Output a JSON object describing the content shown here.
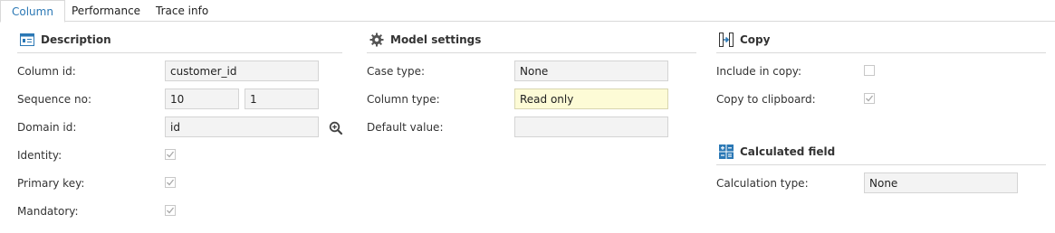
{
  "tabs": [
    {
      "label": "Column",
      "active": true
    },
    {
      "label": "Performance",
      "active": false
    },
    {
      "label": "Trace info",
      "active": false
    }
  ],
  "description": {
    "title": "Description",
    "icon": "id-card-icon",
    "column_id_label": "Column id:",
    "column_id_value": "customer_id",
    "sequence_no_label": "Sequence no:",
    "sequence_no_value1": "10",
    "sequence_no_value2": "1",
    "domain_id_label": "Domain id:",
    "domain_id_value": "id",
    "identity_label": "Identity:",
    "identity_checked": true,
    "primary_key_label": "Primary key:",
    "primary_key_checked": true,
    "mandatory_label": "Mandatory:",
    "mandatory_checked": true
  },
  "model_settings": {
    "title": "Model settings",
    "icon": "gear-icon",
    "case_type_label": "Case type:",
    "case_type_value": "None",
    "column_type_label": "Column type:",
    "column_type_value": "Read only",
    "default_value_label": "Default value:",
    "default_value_value": ""
  },
  "copy": {
    "title": "Copy",
    "icon": "copy-arrow-icon",
    "include_in_copy_label": "Include in copy:",
    "include_in_copy_checked": false,
    "copy_to_clipboard_label": "Copy to clipboard:",
    "copy_to_clipboard_checked": true
  },
  "calculated_field": {
    "title": "Calculated field",
    "icon": "calculator-icon",
    "calculation_type_label": "Calculation type:",
    "calculation_type_value": "None"
  },
  "colors": {
    "accent": "#2b78b5",
    "readonly_field": "#fdfbd6",
    "disabled_field": "#f3f3f3"
  }
}
